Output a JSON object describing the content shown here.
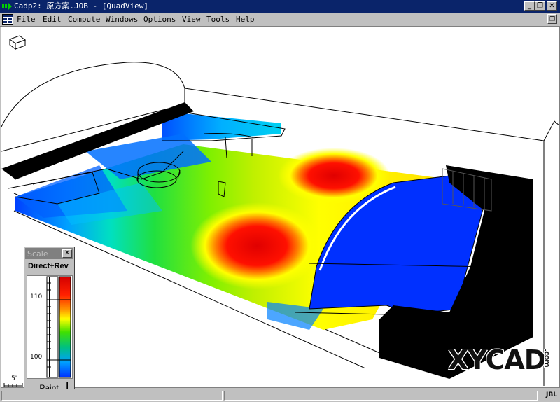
{
  "window": {
    "title": "Cadp2:  原方案.JOB - [QuadView]",
    "minimize_label": "_",
    "restore_label": "❐",
    "close_label": "✕"
  },
  "menu": {
    "items": [
      {
        "label": "File"
      },
      {
        "label": "Edit"
      },
      {
        "label": "Compute"
      },
      {
        "label": "Windows"
      },
      {
        "label": "Options"
      },
      {
        "label": "View"
      },
      {
        "label": "Tools"
      },
      {
        "label": "Help"
      }
    ],
    "restore_label": "❐"
  },
  "scale": {
    "title": "Scale",
    "close_label": "✕",
    "heading": "Direct+Rev",
    "ticks": [
      {
        "label": "110",
        "value": 110
      },
      {
        "label": "100",
        "value": 100
      }
    ],
    "paint_label": "Paint",
    "colors": [
      "#d40000",
      "#ff3000",
      "#ffa000",
      "#ffff00",
      "#30e000",
      "#00c060",
      "#00a0ff",
      "#0030ff"
    ]
  },
  "viewport": {
    "scale_bar_label": "5'",
    "watermark": "XYCAD",
    "watermark_suffix": ".com"
  },
  "status": {
    "brand": "JBL"
  }
}
